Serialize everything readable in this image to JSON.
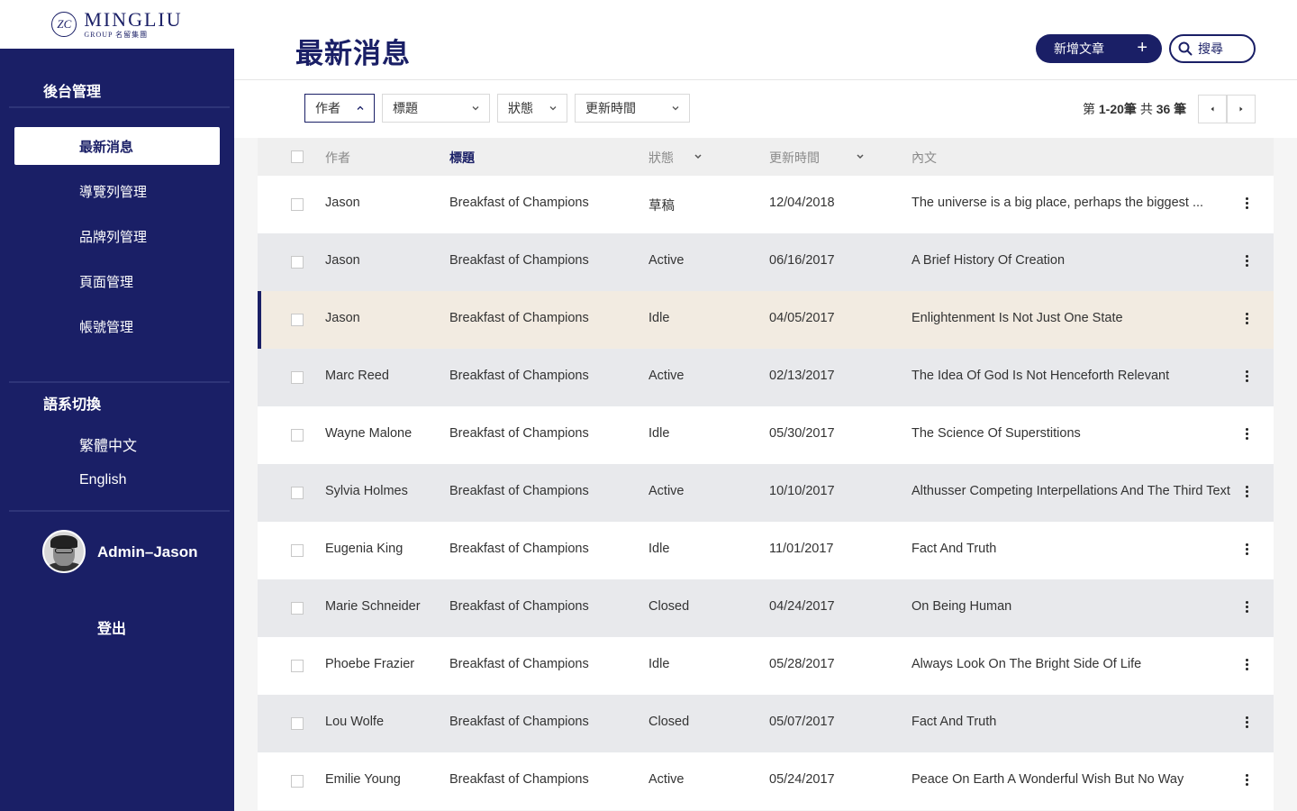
{
  "brand": {
    "name": "MINGLIU",
    "sub": "GROUP 名留集團",
    "mark": "ZC"
  },
  "sidebar": {
    "section_admin": "後台管理",
    "items": [
      {
        "label": "最新消息",
        "active": true
      },
      {
        "label": "導覽列管理"
      },
      {
        "label": "品牌列管理"
      },
      {
        "label": "頁面管理"
      },
      {
        "label": "帳號管理"
      }
    ],
    "section_lang": "語系切換",
    "langs": [
      "繁體中文",
      "English"
    ],
    "user": "Admin–Jason",
    "logout": "登出"
  },
  "header": {
    "title": "最新消息",
    "add_label": "新增文章",
    "search_placeholder": "搜尋"
  },
  "filters": {
    "author": "作者",
    "title": "標題",
    "status": "狀態",
    "updated": "更新時間"
  },
  "pagination": {
    "prefix": "第",
    "range": "1-20筆",
    "middle": "共",
    "total": "36",
    "suffix": "筆"
  },
  "table": {
    "headers": {
      "author": "作者",
      "title": "標題",
      "status": "狀態",
      "updated": "更新時間",
      "content": "內文"
    },
    "rows": [
      {
        "author": "Jason",
        "title": "Breakfast of Champions",
        "status": "草稿",
        "updated": "12/04/2018",
        "content": "The universe is a big place, perhaps the biggest ..."
      },
      {
        "author": "Jason",
        "title": "Breakfast of Champions",
        "status": "Active",
        "updated": "06/16/2017",
        "content": "A Brief History Of Creation"
      },
      {
        "author": "Jason",
        "title": "Breakfast of Champions",
        "status": "Idle",
        "updated": "04/05/2017",
        "content": "Enlightenment Is Not Just One State"
      },
      {
        "author": "Marc Reed",
        "title": "Breakfast of Champions",
        "status": "Active",
        "updated": "02/13/2017",
        "content": "The Idea Of God Is Not Henceforth Relevant"
      },
      {
        "author": "Wayne Malone",
        "title": "Breakfast of Champions",
        "status": "Idle",
        "updated": "05/30/2017",
        "content": "The Science Of Superstitions"
      },
      {
        "author": "Sylvia Holmes",
        "title": "Breakfast of Champions",
        "status": "Active",
        "updated": "10/10/2017",
        "content": "Althusser Competing Interpellations And The Third Text"
      },
      {
        "author": "Eugenia King",
        "title": "Breakfast of Champions",
        "status": "Idle",
        "updated": "11/01/2017",
        "content": "Fact And Truth"
      },
      {
        "author": "Marie Schneider",
        "title": "Breakfast of Champions",
        "status": "Closed",
        "updated": "04/24/2017",
        "content": "On Being Human"
      },
      {
        "author": "Phoebe Frazier",
        "title": "Breakfast of Champions",
        "status": "Idle",
        "updated": "05/28/2017",
        "content": "Always Look On The Bright Side Of Life"
      },
      {
        "author": "Lou Wolfe",
        "title": "Breakfast of Champions",
        "status": "Closed",
        "updated": "05/07/2017",
        "content": "Fact And Truth"
      },
      {
        "author": "Emilie Young",
        "title": "Breakfast of Champions",
        "status": "Active",
        "updated": "05/24/2017",
        "content": "Peace On Earth A Wonderful Wish But No Way"
      }
    ]
  },
  "colors": {
    "primary": "#1a1f66",
    "highlight_row": "#f2ebe1",
    "alt_row": "#e8e9ec"
  }
}
